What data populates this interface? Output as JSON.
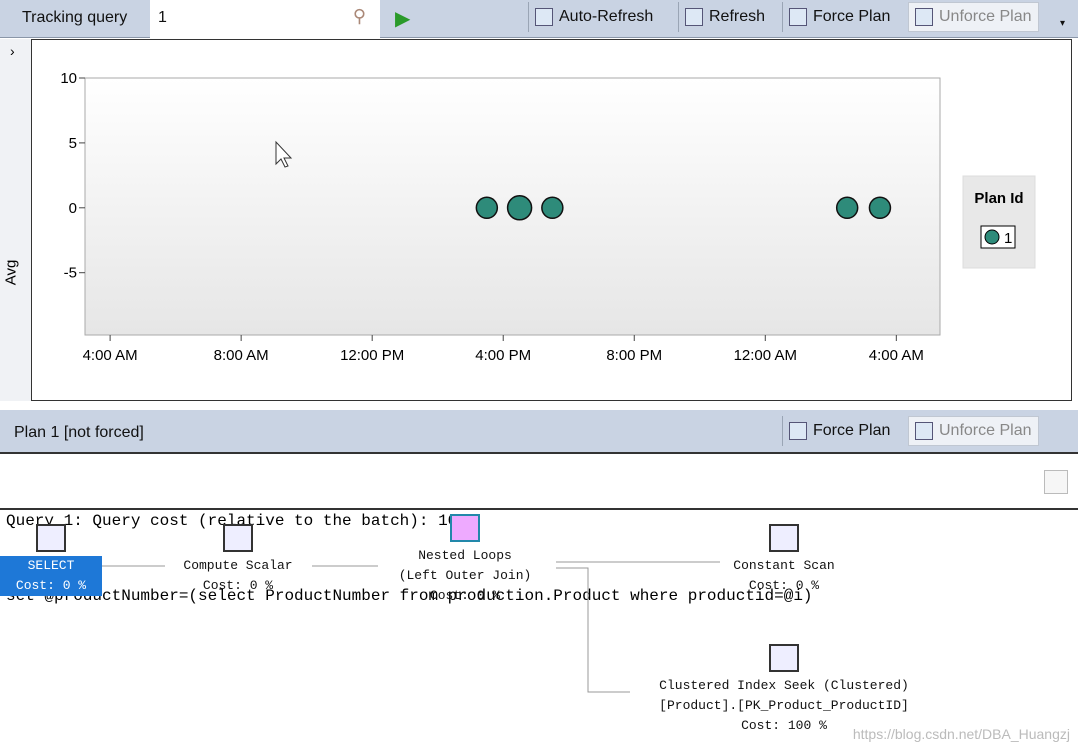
{
  "toolbar": {
    "label": "Tracking query",
    "query_value": "1",
    "auto_refresh": "Auto-Refresh",
    "refresh": "Refresh",
    "force_plan": "Force Plan",
    "unforce_plan": "Unforce Plan"
  },
  "chart_panel": {
    "expand": "›"
  },
  "chart_data": {
    "type": "scatter",
    "ylabel": "Avg",
    "ylim": [
      -9.8,
      10
    ],
    "xlim": [
      "3:14 AM",
      "5:20 AM (next day)"
    ],
    "yticks": [
      "10",
      "5",
      "0",
      "-5"
    ],
    "xticks": [
      "4:00 AM",
      "8:00 AM",
      "12:00 PM",
      "4:00 PM",
      "8:00 PM",
      "12:00 AM",
      "4:00 AM"
    ],
    "series": [
      {
        "name": "1",
        "color": "#2e8b7a",
        "points": [
          {
            "x": "3:30 PM",
            "y": 0
          },
          {
            "x": "4:30 PM",
            "y": 0
          },
          {
            "x": "5:30 PM",
            "y": 0
          },
          {
            "x": "2:30 AM (next day)",
            "y": 0
          },
          {
            "x": "3:30 AM (next day)",
            "y": 0
          }
        ]
      }
    ],
    "legend": {
      "title": "Plan Id",
      "placement": "right"
    },
    "grid": false
  },
  "plan_bar": {
    "title": "Plan 1 [not forced]",
    "force_plan": "Force Plan",
    "unforce_plan": "Unforce Plan"
  },
  "query": {
    "line1": "Query 1: Query cost (relative to the batch): 100%",
    "line2": "set @productNumber=(select ProductNumber from production.Product where productid=@i)"
  },
  "plan": {
    "nodes": [
      {
        "name": "SELECT",
        "cost": "Cost: 0 %"
      },
      {
        "name": "Compute Scalar",
        "cost": "Cost: 0 %"
      },
      {
        "name": "Nested Loops",
        "sub": "(Left Outer Join)",
        "cost": "Cost: 0 %"
      },
      {
        "name": "Constant Scan",
        "cost": "Cost: 0 %"
      },
      {
        "name": "Clustered Index Seek (Clustered)",
        "sub": "[Product].[PK_Product_ProductID]",
        "cost": "Cost: 100 %"
      }
    ]
  },
  "watermark": "https://blog.csdn.net/DBA_Huangzj"
}
